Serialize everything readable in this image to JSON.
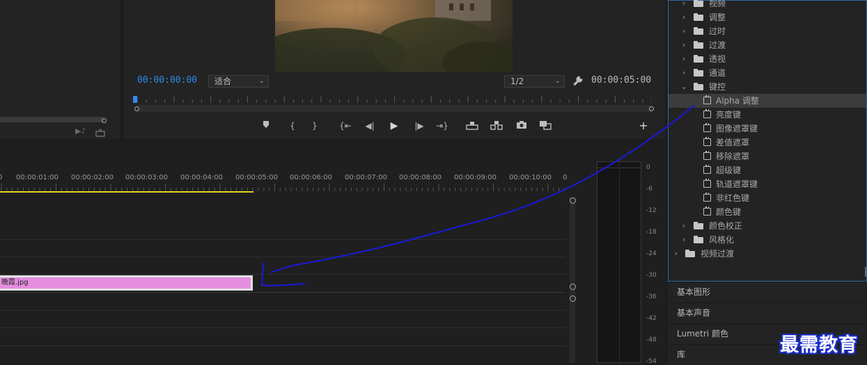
{
  "program_monitor": {
    "timecode_current": "00:00:00:00",
    "timecode_duration": "00:00:05:00",
    "zoom_select": "适合",
    "resolution_select": "1/2"
  },
  "timeline": {
    "ruler_labels": [
      "0",
      "00:00:01:00",
      "00:00:02:00",
      "00:00:03:00",
      "00:00:04:00",
      "00:00:05:00",
      "00:00:06:00",
      "00:00:07:00",
      "00:00:08:00",
      "00:00:09:00",
      "00:00:10:00",
      "0"
    ],
    "clip_name": "晚霞.jpg"
  },
  "audio_meter": {
    "db_labels": [
      "0",
      "-6",
      "-12",
      "-18",
      "-24",
      "-30",
      "-36",
      "-42",
      "-48",
      "-54"
    ]
  },
  "effects_tree": [
    {
      "label": "视频",
      "type": "folder",
      "level": 1,
      "expanded": false
    },
    {
      "label": "调整",
      "type": "folder",
      "level": 1,
      "expanded": false
    },
    {
      "label": "过时",
      "type": "folder",
      "level": 1,
      "expanded": false
    },
    {
      "label": "过渡",
      "type": "folder",
      "level": 1,
      "expanded": false
    },
    {
      "label": "透视",
      "type": "folder",
      "level": 1,
      "expanded": false
    },
    {
      "label": "通道",
      "type": "folder",
      "level": 1,
      "expanded": false
    },
    {
      "label": "键控",
      "type": "folder",
      "level": 1,
      "expanded": true
    },
    {
      "label": "Alpha 调整",
      "type": "effect",
      "level": 2,
      "selected": true
    },
    {
      "label": "亮度键",
      "type": "effect",
      "level": 2
    },
    {
      "label": "图像遮罩键",
      "type": "effect",
      "level": 2
    },
    {
      "label": "差值遮罩",
      "type": "effect",
      "level": 2
    },
    {
      "label": "移除遮罩",
      "type": "effect",
      "level": 2
    },
    {
      "label": "超级键",
      "type": "effect",
      "level": 2
    },
    {
      "label": "轨道遮罩键",
      "type": "effect",
      "level": 2
    },
    {
      "label": "非红色键",
      "type": "effect",
      "level": 2
    },
    {
      "label": "颜色键",
      "type": "effect",
      "level": 2
    },
    {
      "label": "颜色校正",
      "type": "folder",
      "level": 1,
      "expanded": false
    },
    {
      "label": "风格化",
      "type": "folder",
      "level": 1,
      "expanded": false
    },
    {
      "label": "视频过渡",
      "type": "folder",
      "level": 0,
      "expanded": false
    }
  ],
  "panel_tabs": [
    "基本图形",
    "基本声音",
    "Lumetri 颜色",
    "库"
  ],
  "watermark": "最需教育",
  "colors": {
    "accent_blue": "#2d8ceb",
    "clip_pink": "#e58ee0",
    "work_area_yellow": "#e6d21f",
    "annotation_blue": "#1a1acc"
  },
  "icons": [
    "marker-icon",
    "mark-in-icon",
    "mark-out-icon",
    "go-to-in-icon",
    "step-back-icon",
    "play-icon",
    "step-forward-icon",
    "go-to-out-icon",
    "lift-icon",
    "extract-icon",
    "camera-icon",
    "compare-icon",
    "wrench-icon",
    "add-button-icon",
    "folder-icon",
    "effect-icon"
  ]
}
